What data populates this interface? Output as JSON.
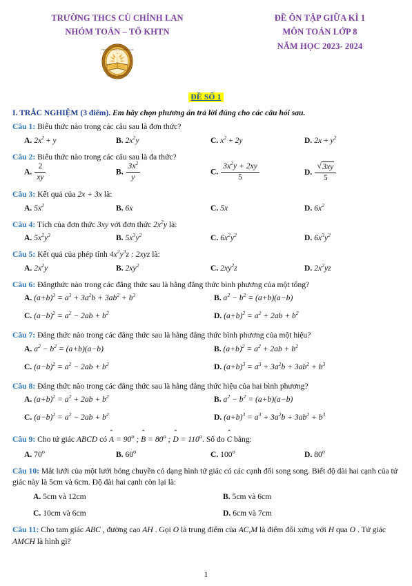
{
  "header": {
    "left_lines": [
      "TRƯỜNG THCS CÙ CHÍNH LAN",
      "NHÓM TOÁN – TỔ KHTN"
    ],
    "right_lines": [
      "ĐỀ ÔN TẬP GIỮA KÌ 1",
      "MÔN TOÁN LỚP 8",
      "NĂM HỌC 2023- 2024"
    ],
    "logo_alt": "school-emblem",
    "title_color": "#7b3fa0"
  },
  "exam_title": {
    "text": "ĐỀ SỐ 1",
    "highlight_color": "#ffff00",
    "text_color": "#1f4e9c"
  },
  "section": {
    "label": "I. TRẮC NGHIỆM (3 điểm).",
    "instruction": "Em hãy chọn phương án trả lời đúng cho các câu hỏi sau.",
    "label_color": "#1f3f8f"
  },
  "question_label_color": "#2e74b5",
  "questions": [
    {
      "num": "Câu 1:",
      "stem": "Biểu thức nào trong các câu sau là đơn thức?",
      "layout": "four-col",
      "options": [
        {
          "letter": "A.",
          "text": "2x² + y"
        },
        {
          "letter": "B.",
          "text": "2x²y"
        },
        {
          "letter": "C.",
          "text": "x² + 2y"
        },
        {
          "letter": "D.",
          "text": "2x + y²"
        }
      ]
    },
    {
      "num": "Câu 2:",
      "stem": "Biểu thức nào trong các câu sau là đa thức?",
      "layout": "four-col-frac",
      "options": [
        {
          "letter": "A.",
          "text": "2/(xy)"
        },
        {
          "letter": "B.",
          "text": "3x²/y"
        },
        {
          "letter": "C.",
          "text": "(3x²y + 2xy)/5"
        },
        {
          "letter": "D.",
          "text": "√(3xy)/5"
        }
      ]
    },
    {
      "num": "Câu 3:",
      "stem_pre": "Kết quả của",
      "stem_math": "2x + 3x",
      "stem_post": "là:",
      "layout": "four-col",
      "options": [
        {
          "letter": "A.",
          "text": "5x²"
        },
        {
          "letter": "B.",
          "text": "6x"
        },
        {
          "letter": "C.",
          "text": "5x"
        },
        {
          "letter": "D.",
          "text": "6x²"
        }
      ]
    },
    {
      "num": "Câu 4:",
      "stem_pre": "Tích của đơn thức",
      "stem_math": "3xy",
      "stem_mid": "với đơn thức",
      "stem_math2": "2x²y",
      "stem_post": "là:",
      "layout": "four-col",
      "options": [
        {
          "letter": "A.",
          "text": "5x²y³"
        },
        {
          "letter": "B.",
          "text": "5x³y²"
        },
        {
          "letter": "C.",
          "text": "6x²y²"
        },
        {
          "letter": "D.",
          "text": "6x³y²"
        }
      ]
    },
    {
      "num": "Câu 5:",
      "stem_pre": "Kết quả của phép tính",
      "stem_math": "4x²y³z : 2xyz",
      "stem_post": "là:",
      "layout": "four-col",
      "options": [
        {
          "letter": "A.",
          "text": "2x²y"
        },
        {
          "letter": "B.",
          "text": "2xy²"
        },
        {
          "letter": "C.",
          "text": "2xy²z"
        },
        {
          "letter": "D.",
          "text": "2x²yz"
        }
      ]
    },
    {
      "num": "Câu 6:",
      "stem": "Đẳngthức nào trong các đẳng thức sau là hằng đẳng thức bình phương của một tổng?",
      "layout": "two-col",
      "options": [
        {
          "letter": "A.",
          "text": "(a+b)³ = a³ + 3a²b + 3ab² + b³"
        },
        {
          "letter": "B.",
          "text": "a² − b² = (a+b)(a−b)"
        },
        {
          "letter": "C.",
          "text": "(a−b)² = a² − 2ab + b²"
        },
        {
          "letter": "D.",
          "text": "(a+b)² = a² + 2ab + b²"
        }
      ]
    },
    {
      "num": "Câu 7:",
      "stem": "Đẳng thức nào trong các đẳng thức sau là hằng đẳng thức bình phương của một hiệu?",
      "layout": "two-col",
      "options": [
        {
          "letter": "A.",
          "text": "a² − b² = (a+b)(a−b)"
        },
        {
          "letter": "B.",
          "text": "(a+b)² = a² + 2ab + b²"
        },
        {
          "letter": "C.",
          "text": "(a−b)² = a² − 2ab + b²"
        },
        {
          "letter": "D.",
          "text": "(a+b)³ = a³ + 3a²b + 3ab² + b³"
        }
      ]
    },
    {
      "num": "Câu 8:",
      "stem": "Đẳng thức nào trong các đẳng thức sau là hằng đẳng thức hiệu của hai bình phương?",
      "layout": "two-col",
      "options": [
        {
          "letter": "A.",
          "text": "(a+b)² = a² + 2ab + b²"
        },
        {
          "letter": "B.",
          "text": "a² − b² = (a+b)(a−b)"
        },
        {
          "letter": "C.",
          "text": "(a−b)² = a² − 2ab + b²"
        },
        {
          "letter": "D.",
          "text": "(a+b)³ = a³ + 3a²b + 3ab² + b³"
        }
      ]
    },
    {
      "num": "Câu 9:",
      "stem_pre": "Cho tứ giác",
      "stem_math": "ABCD",
      "stem_mid": "có",
      "stem_angles": "Â = 90° ; B̂ = 80° ; D̂ = 110°",
      "stem_post": ". Số đo Ĉ bằng:",
      "layout": "four-col",
      "options": [
        {
          "letter": "A.",
          "text": "70°"
        },
        {
          "letter": "B.",
          "text": "60°"
        },
        {
          "letter": "C.",
          "text": "100°"
        },
        {
          "letter": "D.",
          "text": "80°"
        }
      ]
    },
    {
      "num": "Câu 10:",
      "stem": "Mắt lưới của một lưới bóng chuyền có dạng hình tứ giác có các cạnh đối song song. Biết độ dài hai cạnh của tứ giác này là 5cm và 6cm. Độ dài hai cạnh còn lại là:",
      "layout": "two-col-indent",
      "options": [
        {
          "letter": "A.",
          "text": "5cm và 12cm"
        },
        {
          "letter": "B.",
          "text": "5cm và 6cm"
        },
        {
          "letter": "C.",
          "text": "10cm và 6cm"
        },
        {
          "letter": "D.",
          "text": "6cm và 7cm"
        }
      ]
    },
    {
      "num": "Câu 11:",
      "stem": "Cho tam giác ABC, đường cao AH. Gọi O là trung điểm của AC, M là điểm đối xứng với H qua O. Tứ giác AMCH là hình gì?",
      "layout": "none",
      "options": []
    }
  ],
  "page_number": "1"
}
